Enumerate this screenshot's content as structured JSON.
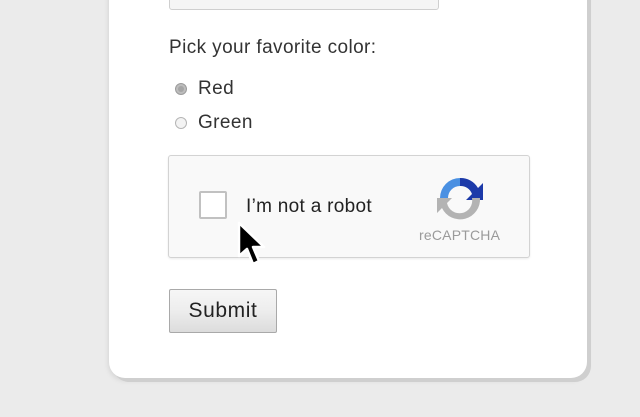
{
  "form": {
    "email_value": "",
    "color_question": "Pick your favorite color:",
    "color_options": [
      {
        "label": "Red",
        "selected": true
      },
      {
        "label": "Green",
        "selected": false
      }
    ],
    "submit_label": "Submit"
  },
  "recaptcha": {
    "checkbox_label": "I’m not a robot",
    "checked": false,
    "brand": "reCAPTCHA",
    "logo_icon": "recaptcha-logo-icon"
  },
  "cursor_icon": "mouse-pointer-icon",
  "colors": {
    "background": "#ebebeb",
    "card": "#ffffff",
    "recaptcha_blue": "#4a90e2",
    "recaptcha_dark_blue": "#1c3aa9",
    "recaptcha_gray": "#b3b3b3"
  }
}
